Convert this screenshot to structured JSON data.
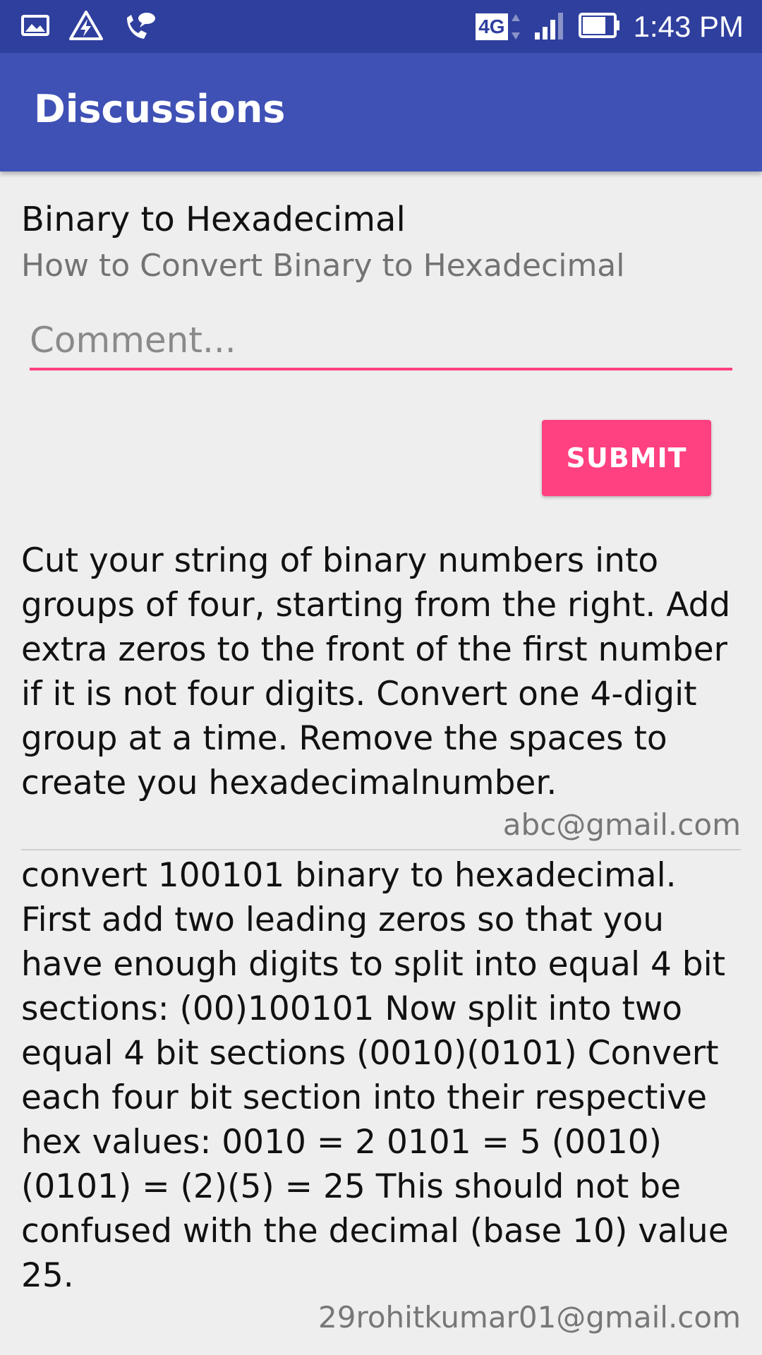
{
  "status_bar": {
    "time": "1:43 PM",
    "network": "4G",
    "icons": [
      "gallery-icon",
      "warning-flash-icon",
      "wifi-call-icon",
      "4g-icon",
      "signal-icon",
      "battery-icon"
    ]
  },
  "app_bar": {
    "title": "Discussions"
  },
  "topic": {
    "title": "Binary to Hexadecimal",
    "subtitle": "How to Convert Binary to Hexadecimal"
  },
  "comment": {
    "placeholder": "Comment...",
    "value": ""
  },
  "submit": {
    "label": "SUBMIT"
  },
  "answers": [
    {
      "text": "Cut your string of binary numbers into groups of four, starting from the right. Add extra zeros to the front of the first number if it is not four digits. Convert one 4-digit group at a time. Remove the spaces to create you hexadecimalnumber.",
      "author": "abc@gmail.com"
    },
    {
      "text": "convert 100101 binary to hexadecimal. First add two leading zeros so that you have enough digits to split into equal 4 bit sections: (00)100101 Now split into two equal 4 bit sections (0010)(0101) Convert each four bit section into their respective hex values: 0010 = 2 0101 = 5 (0010)(0101) = (2)(5) = 25 This should not be confused with the decimal (base 10) value 25.",
      "author": "29rohitkumar01@gmail.com"
    }
  ],
  "colors": {
    "status_bar": "#2f3f9e",
    "app_bar": "#3f51b5",
    "accent": "#ff4081",
    "background": "#eeeeee"
  }
}
